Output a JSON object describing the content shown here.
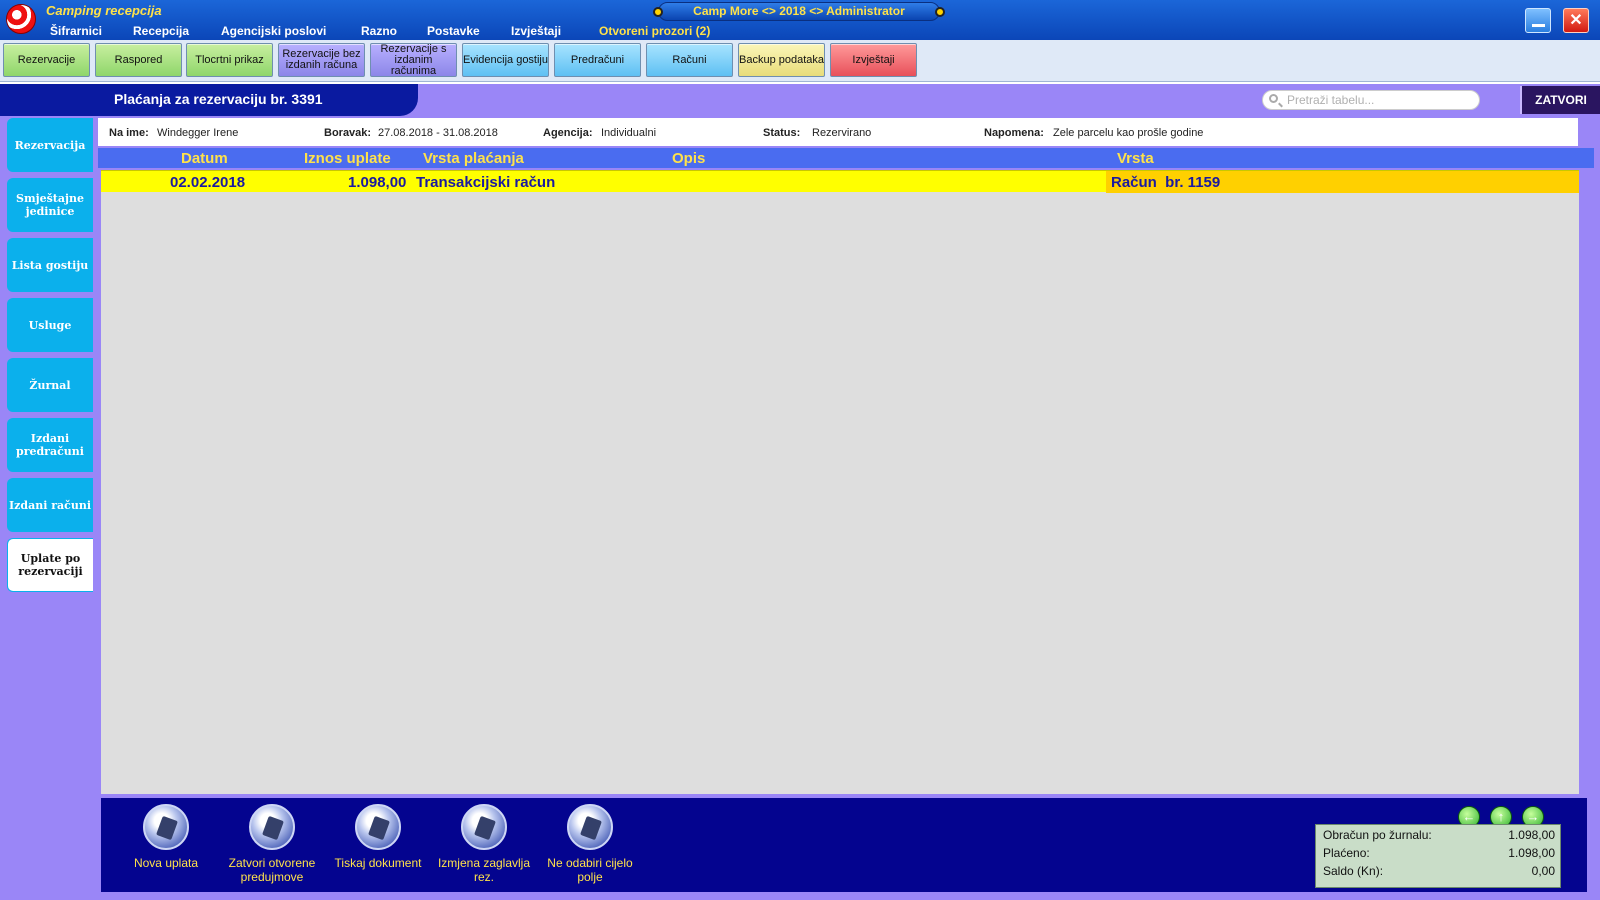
{
  "window": {
    "app_name": "Camping recepcija",
    "session": "Camp More <> 2018 <> Administrator",
    "close_symbol": "✕"
  },
  "menu": [
    "Šifrarnici",
    "Recepcija",
    "Agencijski poslovi",
    "Razno",
    "Postavke",
    "Izvještaji",
    "Otvoreni prozori (2)"
  ],
  "toolbar": [
    {
      "label": "Rezervacije",
      "color": "green"
    },
    {
      "label": "Raspored",
      "color": "green"
    },
    {
      "label": "Tlocrtni prikaz",
      "color": "green"
    },
    {
      "label": "Rezervacije bez izdanih računa",
      "color": "purple"
    },
    {
      "label": "Rezervacije s izdanim računima",
      "color": "purple"
    },
    {
      "label": "Evidencija gostiju",
      "color": "blue"
    },
    {
      "label": "Predračuni",
      "color": "blue"
    },
    {
      "label": "Računi",
      "color": "blue"
    },
    {
      "label": "Backup podataka",
      "color": "yellow"
    },
    {
      "label": "Izvještaji",
      "color": "red"
    }
  ],
  "header": {
    "title": "Plaćanja za rezervaciju br. 3391",
    "search_placeholder": "Pretraži tabelu...",
    "close_label": "ZATVORI"
  },
  "sidebar": {
    "items": [
      {
        "label": "Rezervacija",
        "active": false
      },
      {
        "label": "Smještajne jedinice",
        "active": false
      },
      {
        "label": "Lista gostiju",
        "active": false
      },
      {
        "label": "Usluge",
        "active": false
      },
      {
        "label": "Žurnal",
        "active": false
      },
      {
        "label": "Izdani predračuni",
        "active": false
      },
      {
        "label": "Izdani računi",
        "active": false
      },
      {
        "label": "Uplate po rezervaciji",
        "active": true
      }
    ]
  },
  "info": {
    "name_label": "Na ime:",
    "name_value": "Windegger Irene",
    "stay_label": "Boravak:",
    "stay_value": "27.08.2018 - 31.08.2018",
    "agency_label": "Agencija:",
    "agency_value": "Individualni",
    "status_label": "Status:",
    "status_value": "Rezervirano",
    "note_label": "Napomena:",
    "note_value": "Zele parcelu kao prošle godine"
  },
  "table": {
    "columns": [
      "Datum",
      "Iznos uplate",
      "Vrsta plaćanja",
      "Opis",
      "Vrsta"
    ],
    "rows": [
      [
        "02.02.2018",
        "1.098,00",
        "Transakcijski račun",
        "",
        "Račun  br. 1159"
      ]
    ]
  },
  "actions": [
    {
      "label": "Nova uplata"
    },
    {
      "label": "Zatvori otvorene predujmove"
    },
    {
      "label": "Tiskaj dokument"
    },
    {
      "label": "Izmjena zaglavlja rez."
    },
    {
      "label": "Ne odabiri cijelo polje"
    }
  ],
  "nav_arrows": {
    "prev": "←",
    "up": "↑",
    "next": "→"
  },
  "totals": [
    {
      "label": "Obračun po žurnalu:",
      "value": "1.098,00"
    },
    {
      "label": "Plaćeno:",
      "value": "1.098,00"
    },
    {
      "label": "Saldo (Kn):",
      "value": "0,00"
    }
  ]
}
